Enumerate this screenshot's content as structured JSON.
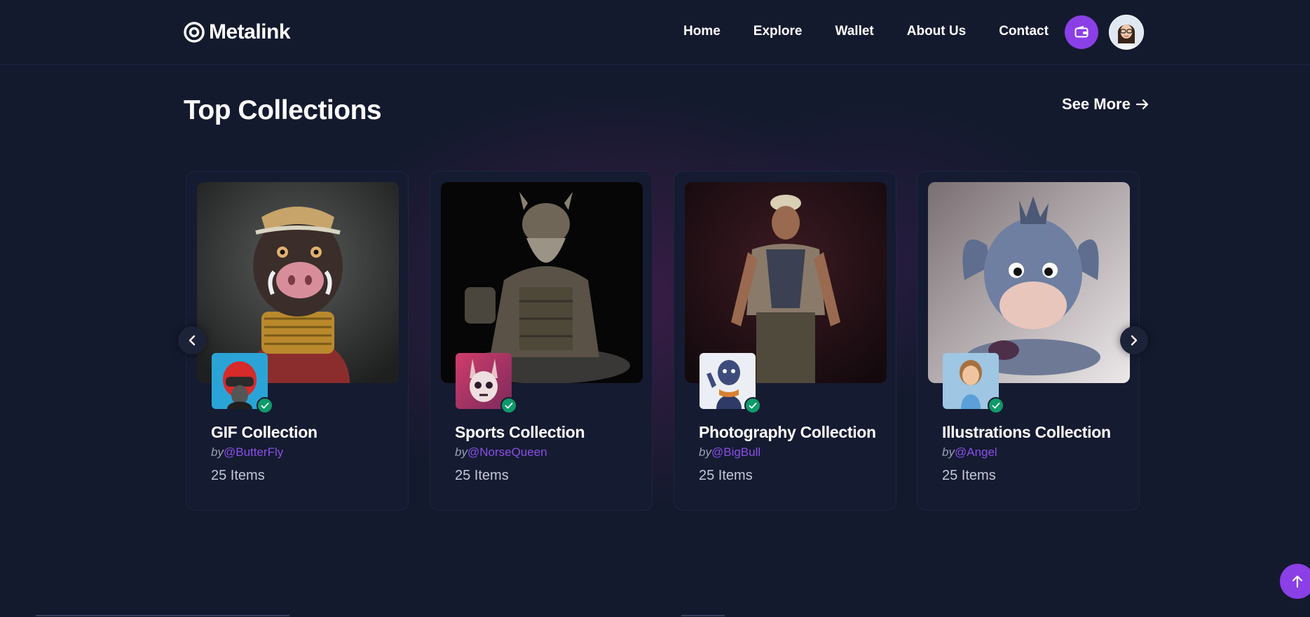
{
  "app": {
    "brand": "Metalink"
  },
  "nav": {
    "items": [
      "Home",
      "Explore",
      "Wallet",
      "About Us",
      "Contact"
    ]
  },
  "header_actions": {
    "wallet_icon": "wallet-icon",
    "avatar": "user-avatar"
  },
  "section": {
    "title": "Top Collections",
    "see_more": "See More"
  },
  "collections": [
    {
      "title": "GIF Collection",
      "by": "by",
      "handle": "@ButterFly",
      "items": "25 Items",
      "verified": true
    },
    {
      "title": "Sports Collection",
      "by": "by",
      "handle": "@NorseQueen",
      "items": "25 Items",
      "verified": true
    },
    {
      "title": "Photography Collection",
      "by": "by",
      "handle": "@BigBull",
      "items": "25 Items",
      "verified": true
    },
    {
      "title": "Illustrations Collection",
      "by": "by",
      "handle": "@Angel",
      "items": "25 Items",
      "verified": true
    }
  ],
  "colors": {
    "background": "#141a2e",
    "card": "#151b31",
    "accent": "#8b3fe6",
    "handle": "#8a4fe8",
    "verified": "#0e9a6a"
  }
}
